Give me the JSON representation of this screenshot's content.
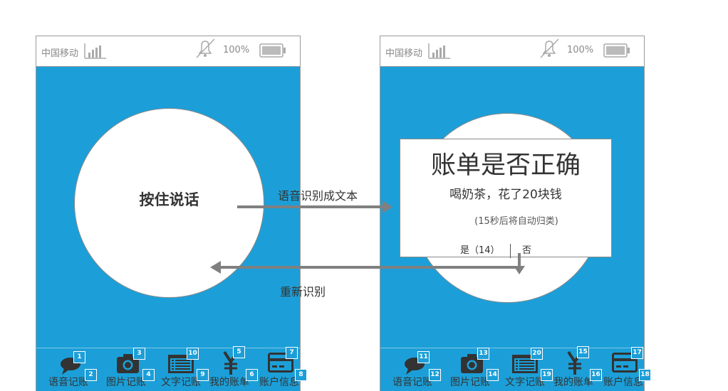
{
  "phones": [
    {
      "carrier": "中国移动",
      "battery_pct": "100%",
      "center_label": "按住说话",
      "tabs": [
        {
          "label": "语音记账",
          "icon": "speech-bubble-icon"
        },
        {
          "label": "图片记账",
          "icon": "camera-icon"
        },
        {
          "label": "文字记账",
          "icon": "text-list-icon"
        },
        {
          "label": "我的账单",
          "icon": "yen-icon"
        },
        {
          "label": "账户信息",
          "icon": "credit-card-icon"
        }
      ],
      "markers": [
        "1",
        "2",
        "3",
        "4",
        "10",
        "9",
        "5",
        "6",
        "7",
        "8"
      ]
    },
    {
      "carrier": "中国移动",
      "battery_pct": "100%",
      "tabs": [
        {
          "label": "语音记账",
          "icon": "speech-bubble-icon"
        },
        {
          "label": "图片记账",
          "icon": "camera-icon"
        },
        {
          "label": "文字记账",
          "icon": "text-list-icon"
        },
        {
          "label": "我的账单",
          "icon": "yen-icon"
        },
        {
          "label": "账户信息",
          "icon": "credit-card-icon"
        }
      ],
      "markers": [
        "11",
        "12",
        "13",
        "14",
        "20",
        "19",
        "15",
        "16",
        "17",
        "18"
      ]
    }
  ],
  "dialog": {
    "title": "账单是否正确",
    "message": "喝奶茶，花了20块钱",
    "note": "(15秒后将自动归类)",
    "yes_label": "是（14）",
    "no_label": "否"
  },
  "flow": {
    "forward_label": "语音识别成文本",
    "back_label": "重新识别"
  },
  "colors": {
    "screen_bg": "#1c9fd8",
    "arrow": "#808080",
    "marker_bg": "#1c9fd8"
  }
}
